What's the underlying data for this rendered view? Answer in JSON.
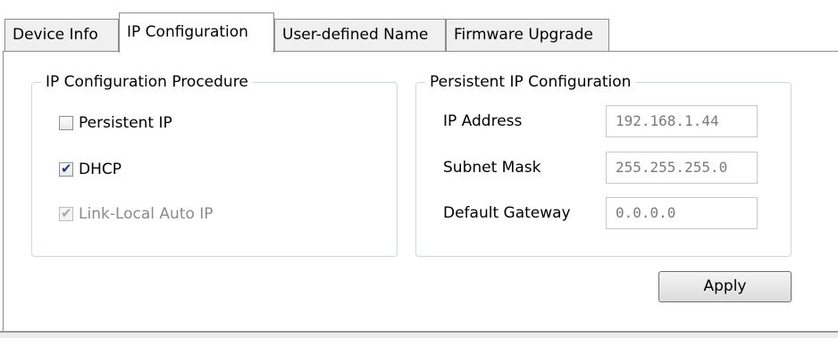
{
  "tabs": [
    {
      "label": "Device Info",
      "active": false
    },
    {
      "label": "IP Configuration",
      "active": true
    },
    {
      "label": "User-defined Name",
      "active": false
    },
    {
      "label": "Firmware Upgrade",
      "active": false
    }
  ],
  "procedure_group": {
    "title": "IP Configuration Procedure",
    "options": [
      {
        "label": "Persistent IP",
        "checked": false,
        "enabled": true
      },
      {
        "label": "DHCP",
        "checked": true,
        "enabled": true
      },
      {
        "label": "Link-Local Auto IP",
        "checked": true,
        "enabled": false
      }
    ]
  },
  "persistent_group": {
    "title": "Persistent IP Configuration",
    "fields": [
      {
        "label": "IP Address",
        "value": "192.168.1.44"
      },
      {
        "label": "Subnet Mask",
        "value": "255.255.255.0"
      },
      {
        "label": "Default Gateway",
        "value": "0.0.0.0"
      }
    ]
  },
  "apply_label": "Apply"
}
